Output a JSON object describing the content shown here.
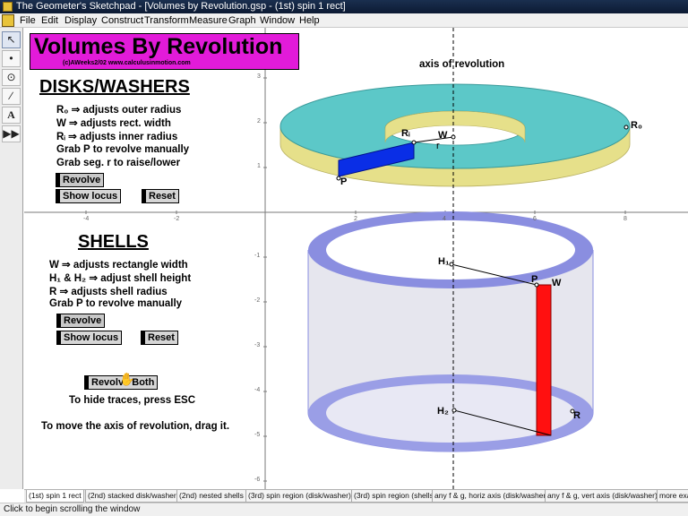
{
  "window": {
    "title": "The Geometer's Sketchpad - [Volumes by Revolution.gsp - (1st)  spin 1 rect]"
  },
  "menu": [
    "File",
    "Edit",
    "Display",
    "Construct",
    "Transform",
    "Measure",
    "Graph",
    "Window",
    "Help"
  ],
  "tools": [
    "arrow-tool",
    "point-tool",
    "compass-tool",
    "straightedge-tool",
    "text-tool",
    "custom-tool"
  ],
  "sketch": {
    "title": "Volumes By Revolution",
    "credit": "(c)AWeeks2/02 www.calculusinmotion.com",
    "axis_label": "axis of revolution",
    "disks": {
      "heading": "DISKS/WASHERS",
      "instructions": [
        "R₀ ⇒ adjusts outer radius",
        "W  ⇒ adjusts rect. width",
        "Rᵢ ⇒ adjusts inner radius",
        "Grab P to revolve manually",
        "Grab seg. r to raise/lower"
      ],
      "revolve_label": "Revolve",
      "show_locus_label": "Show locus",
      "reset_label": "Reset"
    },
    "shells": {
      "heading": "SHELLS",
      "instructions": [
        "W ⇒ adjusts rectangle width",
        "H₁ & H₂ ⇒ adjust shell height",
        "R  ⇒ adjusts shell radius",
        "Grab P to revolve manually"
      ],
      "revolve_label": "Revolve",
      "show_locus_label": "Show locus",
      "reset_label": "Reset"
    },
    "revolve_both_label": "Revolve Both",
    "hide_traces_text": "To hide traces, press ESC",
    "move_axis_text": "To move the axis of revolution, drag it.",
    "x_ticks": [
      "-4",
      "-2",
      "2",
      "4",
      "6",
      "8"
    ],
    "y_ticks": [
      "3",
      "2",
      "1",
      "-1",
      "-2",
      "-3",
      "-4",
      "-5",
      "-6"
    ],
    "points": {
      "R0": "R₀",
      "Ri": "Rᵢ",
      "W_top": "W",
      "r": "r",
      "P_top": "P",
      "H1": "H₁",
      "P_bottom": "P",
      "W_bottom": "W",
      "H2": "H₂",
      "R_bottom": "R"
    }
  },
  "tabs": [
    "(1st)  spin 1 rect",
    "(2nd) stacked disk/washer",
    "(2nd)  nested shells",
    "(3rd) spin region (disk/washer)",
    "(3rd) spin region (shells)",
    "any f & g, horiz axis (disk/washer)",
    "any f & g, vert axis (disk/washer)",
    "more exa"
  ],
  "status": "Click to begin scrolling the window",
  "colors": {
    "banner": "#e21bd9",
    "washer_top": "#5cc8c8",
    "washer_side": "#e6e08a",
    "rect_blue": "#0a2ee6",
    "shell_band": "#8a8ee0",
    "shell_rect": "#ff1010"
  }
}
